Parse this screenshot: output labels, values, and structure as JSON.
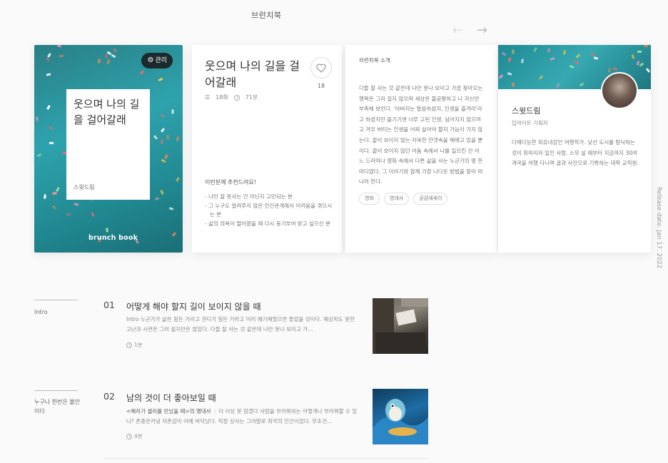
{
  "header": {
    "title": "브런치북",
    "prev_icon": "arrow-left-icon",
    "next_icon": "arrow-right-icon"
  },
  "release_date": "Release date. Jan 17. 2022",
  "cover": {
    "manage_label": "관리",
    "title": "웃으며 나의 길을 걸어갈래",
    "author": "스윗드림",
    "logo": "brunch book",
    "bg_color": "#2ea3ad"
  },
  "info": {
    "title": "웃으며 나의 길을 걸어갈래",
    "likes": "18",
    "episodes": "18화",
    "duration": "71분",
    "recommend_title": "이런분께 추천드려요!",
    "recommend": [
      "나만 잘 못사는 건 아닌지 고민되는 분",
      "그 누구도 알려주지 않은 인간관계에서 어려움을 겪으시는 분",
      "삶의 의욕이 떨어졌을 때 다시 동기부여 받고 싶으신 분"
    ]
  },
  "about": {
    "heading": "브런치북 소개",
    "body": "다들 잘 사는 것 같은데 나만 못나 보이고 가끔 찾아오는 행복은 그리 길지 않으며 세상은 불공평하고 나 자신만 부족해 보인다. '아버지는 말씀하셨지, 인생을 즐겨라'라고 하셨지만 즐기기엔 너무 고된 인생. 넘어지지 않으려고 겨우 버티는 인생을 어찌 살아야 할지 가늠이 가지 않는다. 끝이 보이지 않는 자욱한 안갯속을 헤매고 있을 뿐이다. 끝이 보이지 않던 어둠 속에서 나를 일으킨 건 어느 드라마나 영화 속에서 다른 삶을 사는 누군가의 명 한마디였다. 그 이야기와 함께 가장 나다운 방법을 찾아 떠나려 한다.",
    "tags": [
      "영화",
      "명대사",
      "공감에세이"
    ]
  },
  "author": {
    "name": "스윗드림",
    "role": "딥라이트 기획자",
    "bio": "다채다능한 외유내강인 여행작가. 낯선 도시를 탐닉하는 것이 취미이자 일인 사람. 스무 살 때부터 지금까지 30여 개국을 여행 다니며 글과 사진으로 기록하는 대학 교직원."
  },
  "toc": [
    {
      "section": "Intro",
      "number": "01",
      "title": "어떻게 해야 할지 길이 보이지 않을 때",
      "lead": "Intro",
      "desc": "Intro 누군가가 삶은 힘든 거라고 견디기 힘든 거라고 미리 얘기해줬으면 좋았을 것이다. 예상치도 못한 고난과 시련은 그리 쉽지만은 않았다. 다들 잘 사는 것 같은데 나만 못나 보이고 가…",
      "time": "1분"
    },
    {
      "section": "누구나 한번은 불안이다",
      "number": "02",
      "title": "남의 것이 더 좋아보일 때",
      "lead": "<해리가 샐리를 만났을 때>의 명대사",
      "desc": "더 이상 못 참겠다 사람을 부러워하는 어떻게나 부러워할 수 있나? 존중은커녕 자존감이 아예 바닥났다. 직장 상사는 그야말로 최악의 인간이었다. 무조건…",
      "time": "4분"
    }
  ]
}
